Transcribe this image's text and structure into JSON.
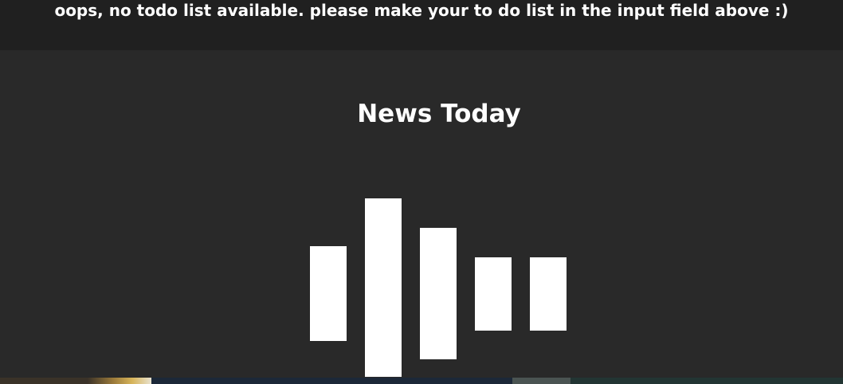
{
  "todo": {
    "empty_message": "oops, no todo list available. please make your to do list in the input field above :)"
  },
  "news": {
    "title": "News Today",
    "loader": {
      "bar_count": 5
    }
  },
  "colors": {
    "page_background": "#292929",
    "todo_background": "#202020",
    "text": "#ffffff",
    "loader_bar": "#ffffff"
  }
}
